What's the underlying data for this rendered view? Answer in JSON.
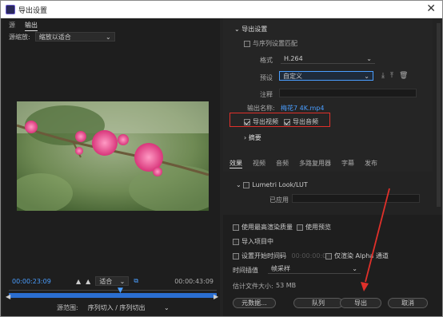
{
  "window": {
    "title": "导出设置",
    "close_label": "✕"
  },
  "left": {
    "tabs": [
      {
        "label": "源"
      },
      {
        "label": "输出"
      }
    ],
    "source_scale_label": "源缩放:",
    "source_scale_value": "缩放以适合",
    "timecode_start": "00:00:23:09",
    "fit_value": "适合",
    "timecode_end": "00:00:43:09",
    "range_label": "源范围:",
    "range_value": "序列切入 / 序列切出"
  },
  "export": {
    "header": "导出设置",
    "match_sequence_label": "与序列设置匹配",
    "format_label": "格式",
    "format_value": "H.264",
    "preset_label": "预设",
    "preset_value": "自定义",
    "comment_label": "注释",
    "output_name_label": "输出名称:",
    "output_name_value": "梅花7 4K.mp4",
    "export_video_label": "导出视频",
    "export_audio_label": "导出音频",
    "summary_label": "摘要",
    "tabs": [
      {
        "label": "效果"
      },
      {
        "label": "视频"
      },
      {
        "label": "音频"
      },
      {
        "label": "多路复用器"
      },
      {
        "label": "字幕"
      },
      {
        "label": "发布"
      }
    ],
    "lumetri_label": "Lumetri Look/LUT",
    "applied_label": "已应用"
  },
  "bottom": {
    "max_render_label": "使用最高渲染质量",
    "use_preview_label": "使用预览",
    "import_project_label": "导入项目中",
    "set_start_tc_label": "设置开始时间码",
    "start_tc_value": "00:00:00:00",
    "alpha_label": "仅渲染 Alpha 通道",
    "interp_label": "时间插值",
    "interp_value": "帧采样",
    "filesize_label": "估计文件大小:",
    "filesize_value": "53 MB",
    "metadata_btn": "元数据...",
    "queue_btn": "队列",
    "export_btn": "导出",
    "cancel_btn": "取消"
  },
  "colors": {
    "highlight_red": "#e0302a",
    "accent_blue": "#4a9eff",
    "timeline_blue": "#2b6ed0"
  }
}
